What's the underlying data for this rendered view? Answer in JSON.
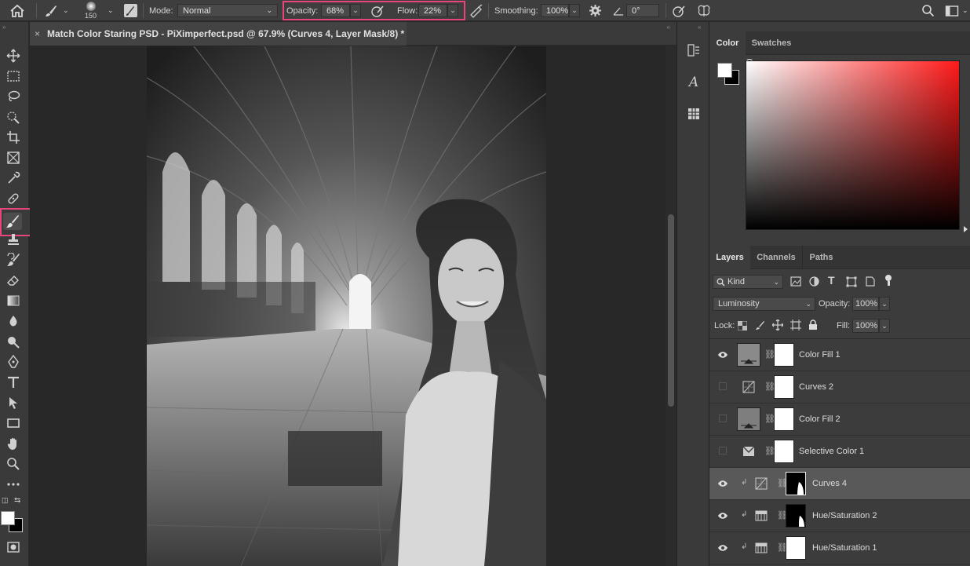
{
  "options_bar": {
    "brush_size": "150",
    "mode_label": "Mode:",
    "mode_value": "Normal",
    "opacity_label": "Opacity:",
    "opacity_value": "68%",
    "flow_label": "Flow:",
    "flow_value": "22%",
    "smoothing_label": "Smoothing:",
    "smoothing_value": "100%",
    "angle_value": "0°"
  },
  "document": {
    "tab_title": "Match Color Staring PSD - PiXimperfect.psd @ 67.9% (Curves 4, Layer Mask/8) *"
  },
  "color_panel": {
    "tabs": [
      "Color",
      "Swatches"
    ],
    "foreground": "#ffffff",
    "background": "#000000",
    "hue_color": "#ff1a1a"
  },
  "layers_panel": {
    "tabs": [
      "Layers",
      "Channels",
      "Paths"
    ],
    "filter_label": "Kind",
    "blend_mode": "Luminosity",
    "opacity_label": "Opacity:",
    "opacity_value": "100%",
    "lock_label": "Lock:",
    "fill_label": "Fill:",
    "fill_value": "100%",
    "layers": [
      {
        "name": "Color Fill 1",
        "visible": true,
        "type": "color-fill"
      },
      {
        "name": "Curves 2",
        "visible": false,
        "type": "curves"
      },
      {
        "name": "Color Fill 2",
        "visible": false,
        "type": "color-fill"
      },
      {
        "name": "Selective Color 1",
        "visible": false,
        "type": "selective-color"
      },
      {
        "name": "Curves 4",
        "visible": true,
        "type": "curves",
        "selected": true,
        "clipped": true
      },
      {
        "name": "Hue/Saturation 2",
        "visible": true,
        "type": "hue-saturation",
        "clipped": true
      },
      {
        "name": "Hue/Saturation 1",
        "visible": true,
        "type": "hue-saturation",
        "clipped": true
      }
    ]
  },
  "colors": {
    "accent_highlight": "#e8457a"
  }
}
